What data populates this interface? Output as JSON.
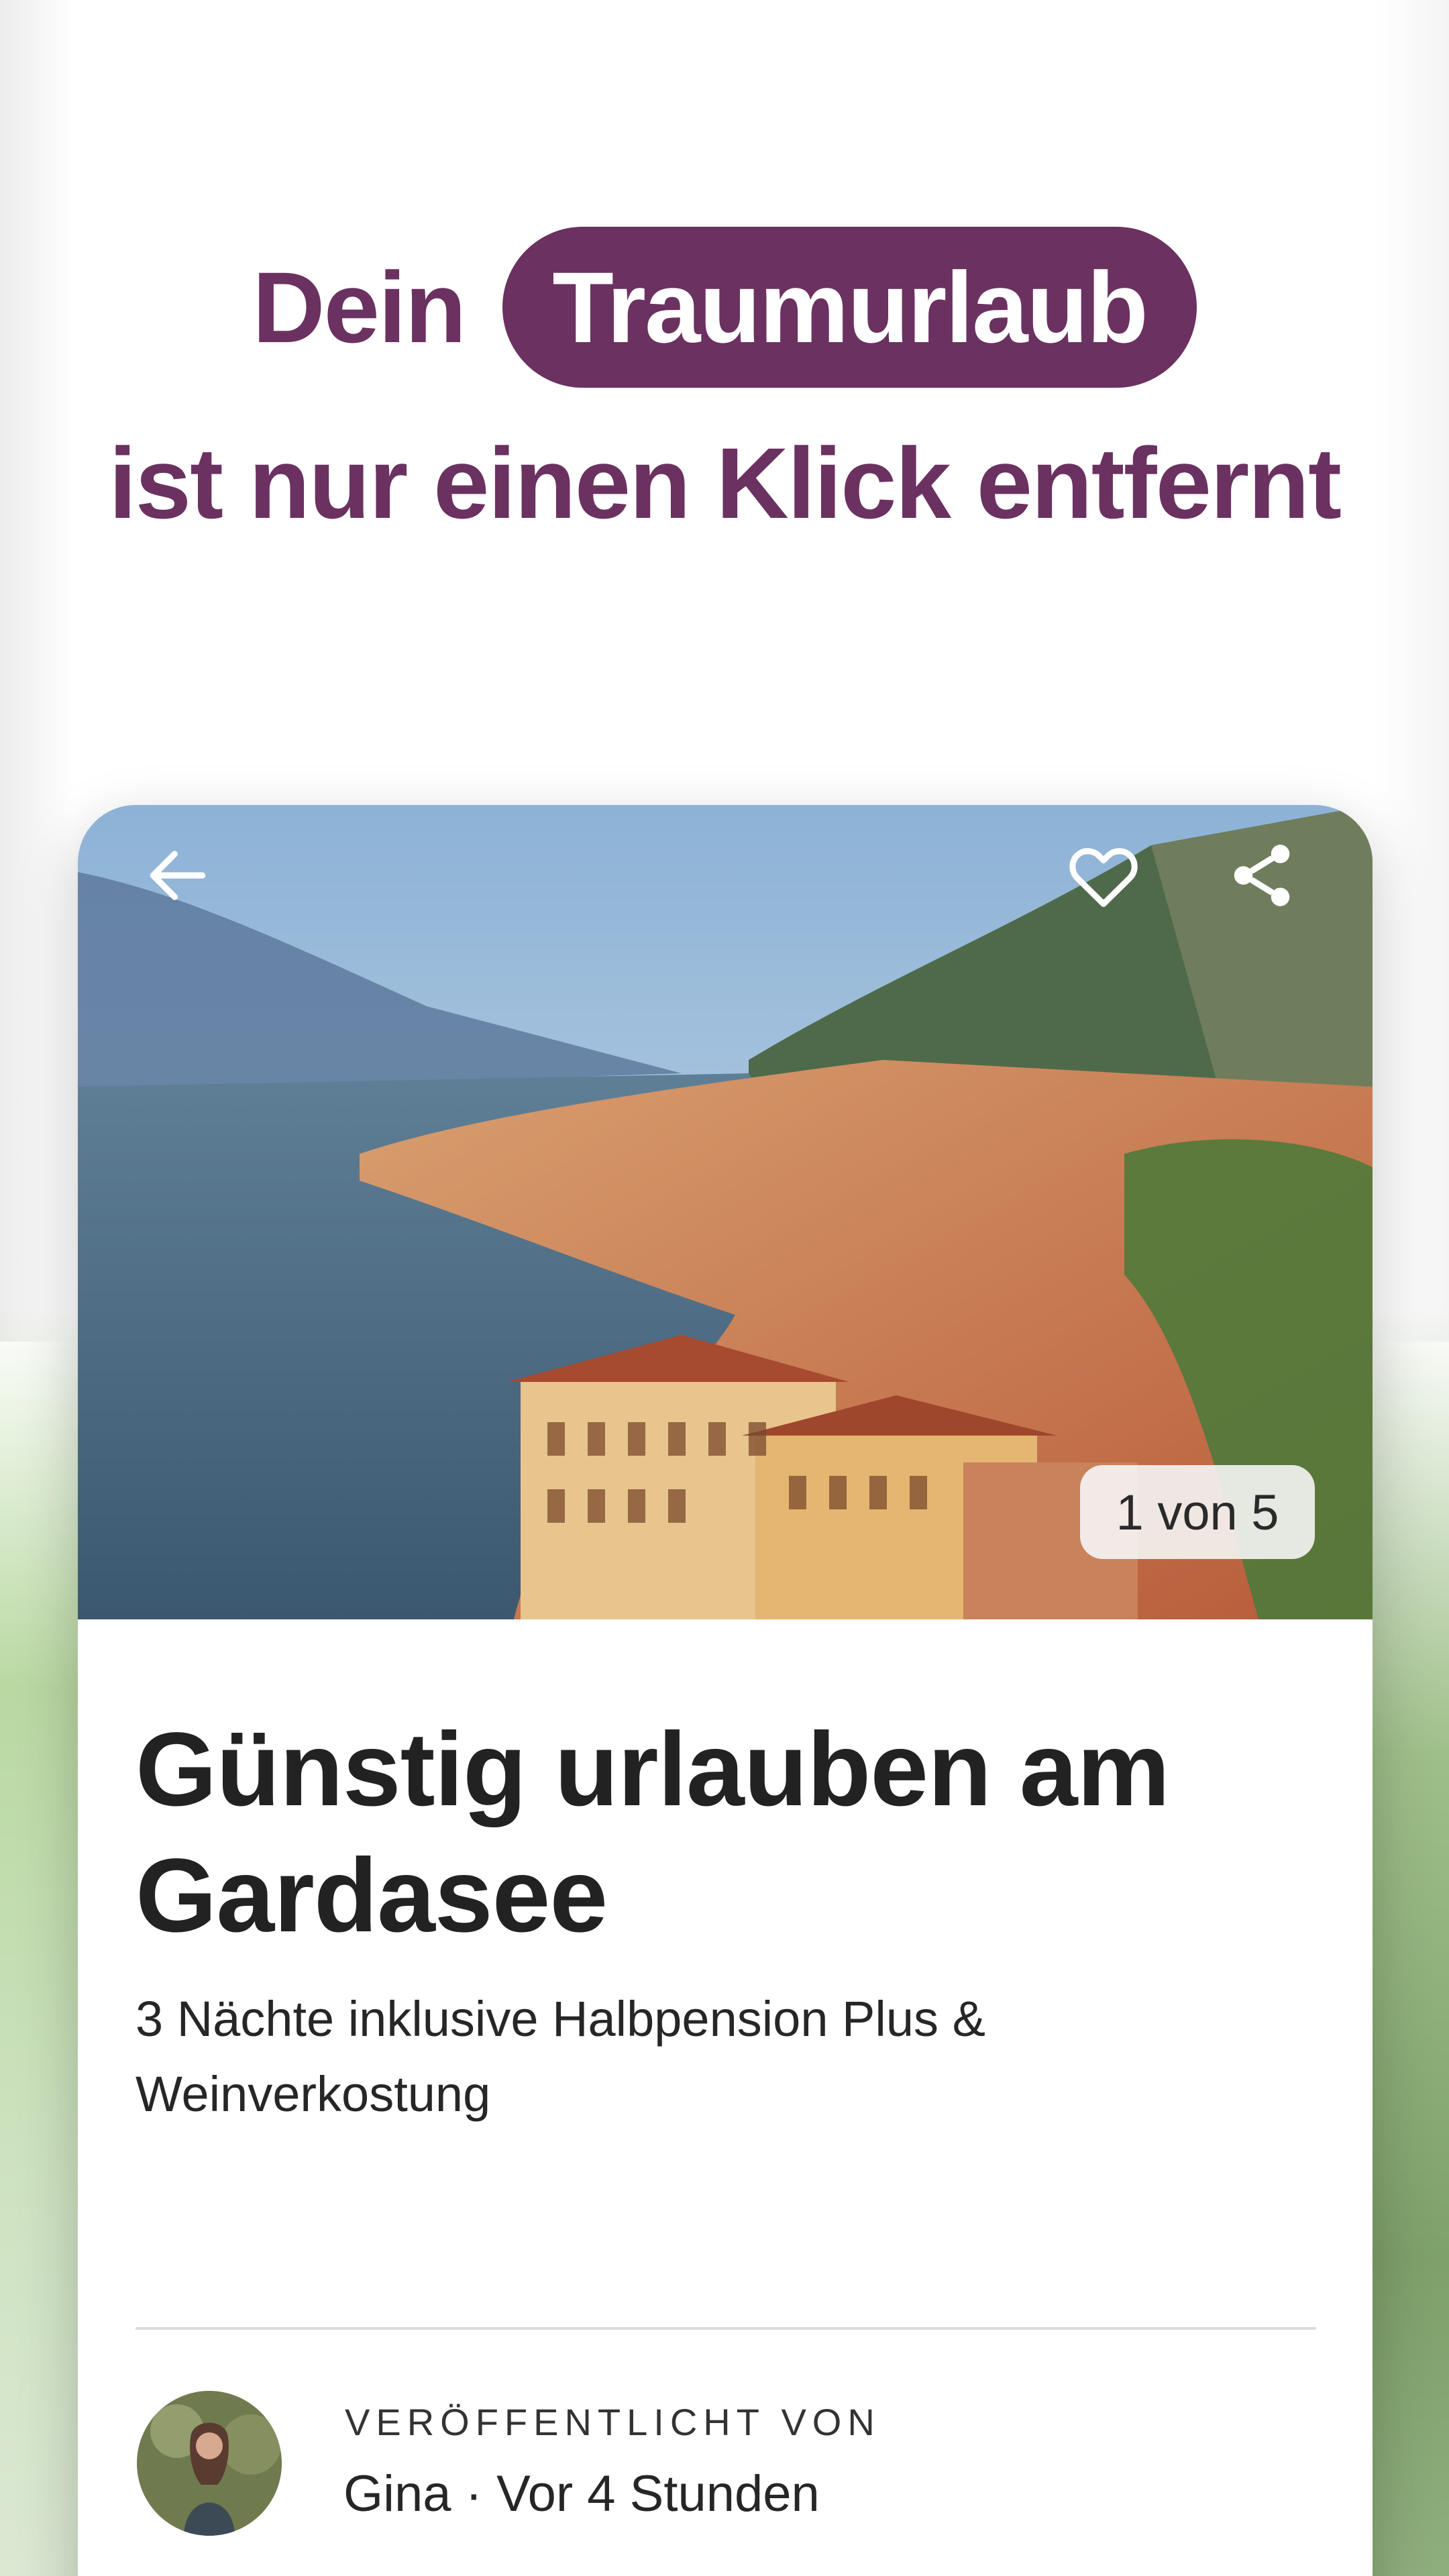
{
  "headline": {
    "prefix": "Dein",
    "highlight": "Traumurlaub",
    "line2": "ist nur einen Klick entfernt"
  },
  "card": {
    "image_counter": "1 von 5",
    "title": "Günstig urlauben am Gardasee",
    "subtitle": "3 Nächte inklusive Halbpension Plus & Weinverkostung",
    "author_label": "VERÖFFENTLICHT VON",
    "author_meta": "Gina · Vor 4 Stunden",
    "icons": {
      "back": "arrow-left-icon",
      "favorite": "heart-icon",
      "share": "share-icon"
    }
  },
  "colors": {
    "brand": "#6b3160",
    "text": "#222222"
  }
}
